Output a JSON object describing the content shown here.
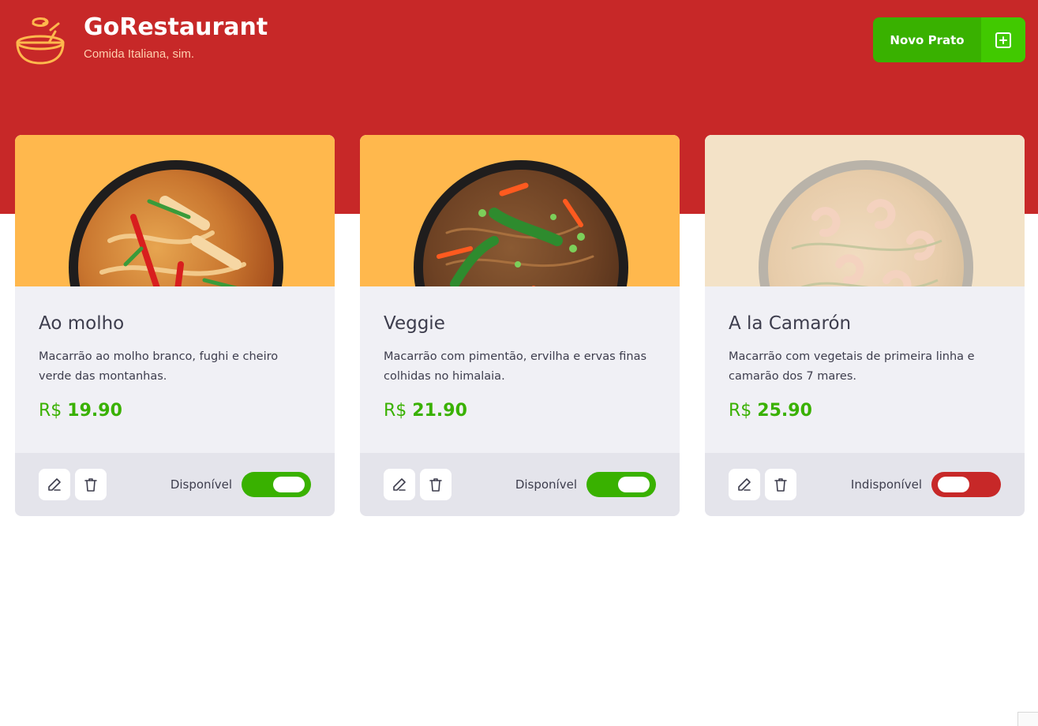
{
  "header": {
    "title": "GoRestaurant",
    "subtitle": "Comida Italiana, sim.",
    "logo_icon": "bowl-icon",
    "new_button_label": "Novo Prato",
    "new_button_icon": "plus-square-icon"
  },
  "colors": {
    "header_red": "#c72828",
    "accent_green": "#39b100",
    "button_green_light": "#41c900",
    "logo_orange": "#ffb84d",
    "card_bg": "#f0f0f5",
    "footer_bg": "#e4e4eb",
    "image_bg": "#ffb84d"
  },
  "foods": [
    {
      "name": "Ao molho",
      "description": "Macarrão ao molho branco, fughi e cheiro verde das montanhas.",
      "currency": "R$",
      "price": "19.90",
      "available": true,
      "availability_label": "Disponível",
      "edit_icon": "pencil-icon",
      "delete_icon": "trash-icon"
    },
    {
      "name": "Veggie",
      "description": "Macarrão com pimentão, ervilha e ervas finas colhidas no himalaia.",
      "currency": "R$",
      "price": "21.90",
      "available": true,
      "availability_label": "Disponível",
      "edit_icon": "pencil-icon",
      "delete_icon": "trash-icon"
    },
    {
      "name": "A la Camarón",
      "description": "Macarrão com vegetais de primeira linha e camarão dos 7 mares.",
      "currency": "R$",
      "price": "25.90",
      "available": false,
      "availability_label": "Indisponível",
      "edit_icon": "pencil-icon",
      "delete_icon": "trash-icon"
    }
  ]
}
